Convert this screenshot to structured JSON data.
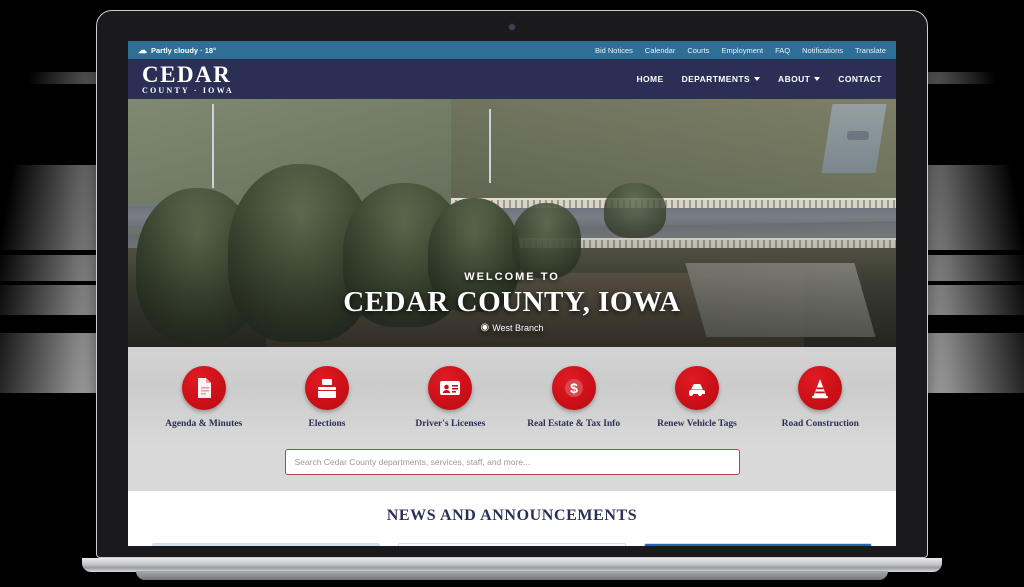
{
  "utility_bar": {
    "weather": {
      "icon": "cloud-icon",
      "text": "Partly cloudy · 18°"
    },
    "links": [
      {
        "label": "Bid Notices"
      },
      {
        "label": "Calendar"
      },
      {
        "label": "Courts"
      },
      {
        "label": "Employment"
      },
      {
        "label": "FAQ"
      },
      {
        "label": "Notifications"
      },
      {
        "label": "Translate"
      }
    ]
  },
  "header": {
    "logo_main": "CEDAR",
    "logo_sub": "COUNTY · IOWA",
    "nav": [
      {
        "label": "HOME",
        "caret": false
      },
      {
        "label": "DEPARTMENTS",
        "caret": true
      },
      {
        "label": "ABOUT",
        "caret": true
      },
      {
        "label": "CONTACT",
        "caret": false
      }
    ]
  },
  "hero": {
    "eyebrow": "WELCOME TO",
    "title": "CEDAR COUNTY, IOWA",
    "location": "West Branch",
    "location_icon": "map-pin-icon"
  },
  "quick_links": [
    {
      "label": "Agenda & Minutes",
      "icon": "document-icon"
    },
    {
      "label": "Elections",
      "icon": "ballot-box-icon"
    },
    {
      "label": "Driver's Licenses",
      "icon": "id-card-icon"
    },
    {
      "label": "Real Estate & Tax Info",
      "icon": "dollar-sign-icon"
    },
    {
      "label": "Renew Vehicle Tags",
      "icon": "car-icon"
    },
    {
      "label": "Road Construction",
      "icon": "traffic-cone-icon"
    }
  ],
  "search": {
    "placeholder": "Search Cedar County departments, services, staff, and more...",
    "value": ""
  },
  "news": {
    "heading": "NEWS AND ANNOUNCEMENTS"
  },
  "colors": {
    "utility_bar": "#2e6f96",
    "header_navy": "#2b2f55",
    "accent_red": "#cc1017",
    "quick_links_band": "#d3d3d3"
  }
}
